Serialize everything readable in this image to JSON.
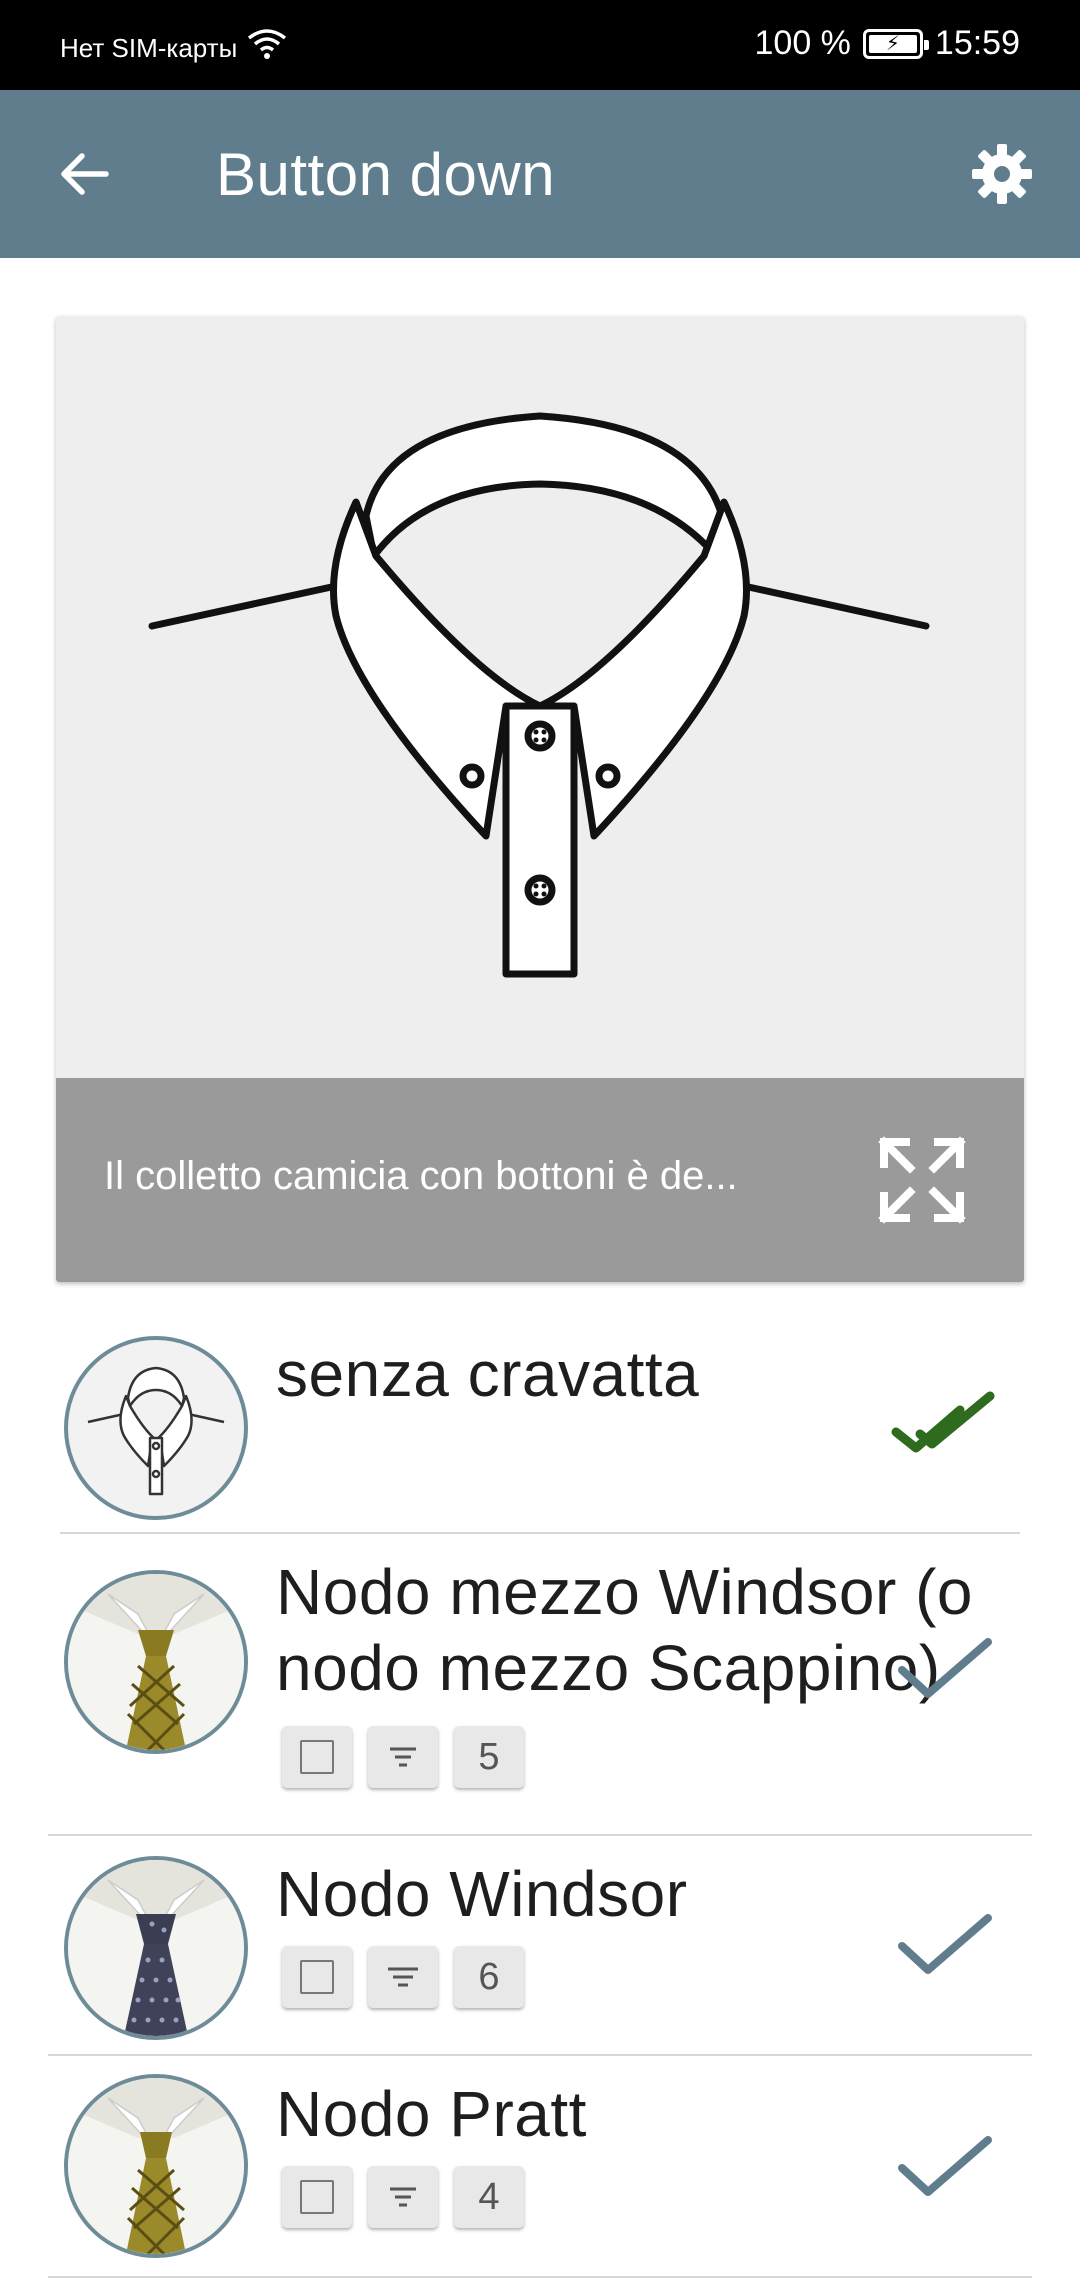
{
  "status_bar": {
    "carrier": "Нет SIM-карты",
    "battery": "100 %",
    "time": "15:59"
  },
  "app_bar": {
    "title": "Button down",
    "back_icon": "arrow-back-icon",
    "settings_icon": "gear-icon",
    "color": "#5f7d8c"
  },
  "card": {
    "description": "Il colletto camicia con bottoni è de...",
    "image": "shirt-collar-illustration",
    "expand_icon": "expand-icon"
  },
  "list": {
    "items": [
      {
        "title": "senza cravatta",
        "check": "double-check-icon",
        "check_color": "#2e6b1f",
        "chips": []
      },
      {
        "title_line1": "Nodo mezzo Windsor (o",
        "title_line2": "nodo mezzo Scappino)",
        "check": "check-icon",
        "check_color": "#5f7d8c",
        "chips": {
          "value": "5"
        }
      },
      {
        "title": "Nodo Windsor",
        "check": "check-icon",
        "check_color": "#5f7d8c",
        "chips": {
          "value": "6"
        }
      },
      {
        "title": "Nodo Pratt",
        "check": "check-icon",
        "check_color": "#5f7d8c",
        "chips": {
          "value": "4"
        }
      }
    ]
  }
}
